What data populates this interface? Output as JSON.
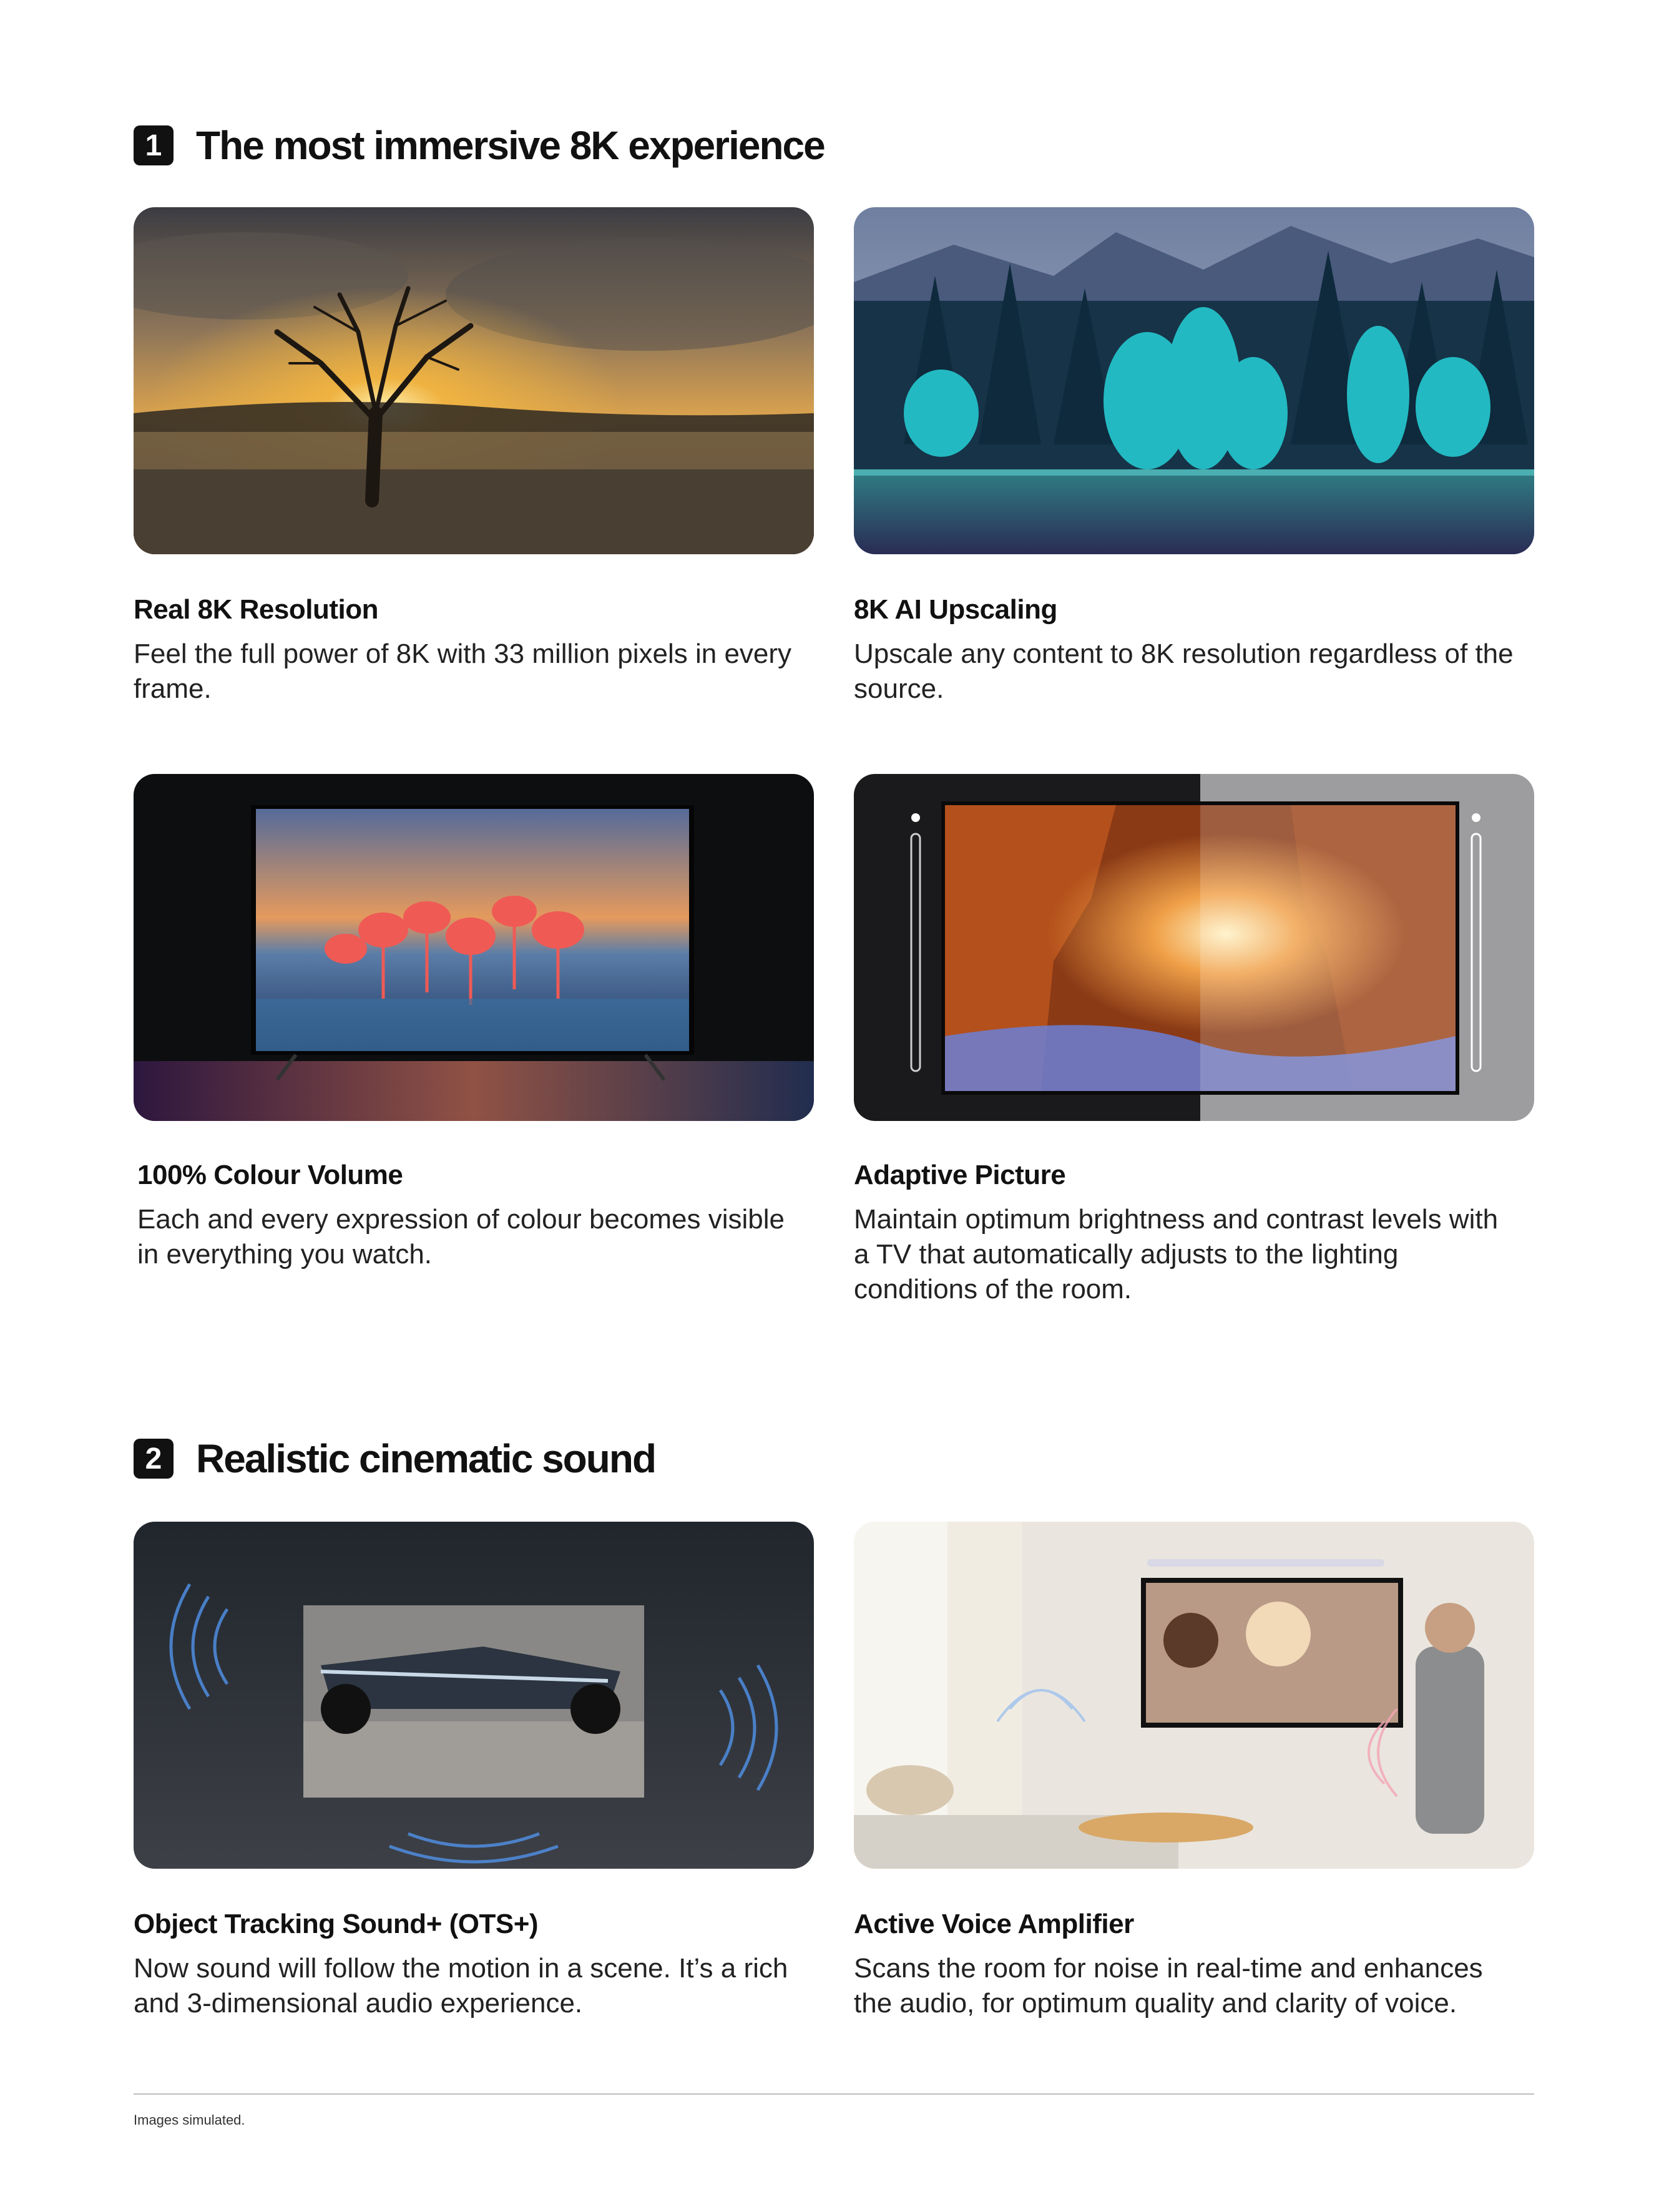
{
  "sections": [
    {
      "number": "1",
      "title": "The most immersive 8K experience"
    },
    {
      "number": "2",
      "title": "Realistic cinematic sound"
    }
  ],
  "features": [
    {
      "title": "Real 8K Resolution",
      "desc": "Feel the full power of 8K with 33 million pixels in every frame."
    },
    {
      "title": "8K AI Upscaling",
      "desc": "Upscale any content to 8K resolution regardless of the source."
    },
    {
      "title": "100% Colour Volume",
      "desc": "Each and every expression of colour becomes visible in everything you watch."
    },
    {
      "title": "Adaptive Picture",
      "desc": "Maintain optimum brightness and contrast levels with a TV that automatically adjusts to the lighting conditions of the room."
    },
    {
      "title": "Object Tracking Sound+  (OTS+)",
      "desc": "Now sound will follow the motion in a scene. It’s a rich and 3-dimensional audio experience."
    },
    {
      "title": "Active Voice Amplifier",
      "desc": "Scans the room for noise in real-time and enhances the audio, for optimum quality and clarity of voice."
    }
  ],
  "footnote": "Images simulated.",
  "colors": {
    "text": "#111111",
    "badge": "#111111",
    "rule": "#bdbdbd"
  }
}
